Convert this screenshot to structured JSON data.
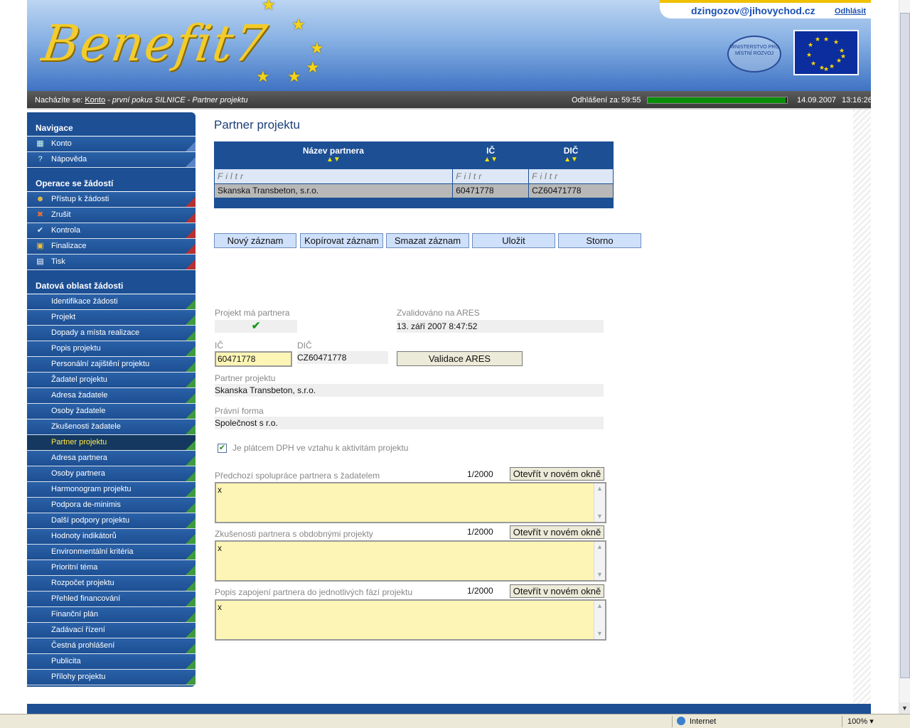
{
  "header": {
    "logo_text": "Benefit7",
    "user_email": "dzingozov@jihovychod.cz",
    "logout_label": "Odhlásit",
    "ministry_text": "MINISTERSTVO PRO MÍSTNÍ ROZVOJ"
  },
  "status": {
    "location_prefix": "Nacházíte se:",
    "location_link": "Konto",
    "location_rest": "- první pokus SILNICE - Partner projektu",
    "timeout_label": "Odhlášení za:",
    "timeout_value": "59:55",
    "timeout_progress_fraction": 0.99,
    "date": "14.09.2007",
    "time": "13:16:26"
  },
  "sidebar": {
    "nav_title": "Navigace",
    "nav_items": [
      {
        "label": "Konto",
        "icon": "account-icon"
      },
      {
        "label": "Nápověda",
        "icon": "help-icon"
      }
    ],
    "ops_title": "Operace se žádostí",
    "ops_items": [
      {
        "label": "Přístup k žádosti",
        "icon": "users-icon"
      },
      {
        "label": "Zrušit",
        "icon": "cancel-icon"
      },
      {
        "label": "Kontrola",
        "icon": "check-icon"
      },
      {
        "label": "Finalizace",
        "icon": "lock-icon"
      },
      {
        "label": "Tisk",
        "icon": "print-icon"
      }
    ],
    "data_title": "Datová oblast žádosti",
    "data_items": [
      "Identifikace žádosti",
      "Projekt",
      "Dopady a místa realizace",
      "Popis projektu",
      "Personální zajištění projektu",
      "Žadatel projektu",
      "Adresa žadatele",
      "Osoby žadatele",
      "Zkušenosti žadatele",
      "Partner projektu",
      "Adresa partnera",
      "Osoby partnera",
      "Harmonogram projektu",
      "Podpora de-minimis",
      "Další podpory projektu",
      "Hodnoty indikátorů",
      "Environmentální kritéria",
      "Prioritní téma",
      "Rozpočet projektu",
      "Přehled financování",
      "Finanční plán",
      "Zadávací řízení",
      "Čestná prohlášení",
      "Publicita",
      "Přílohy projektu"
    ],
    "active_item": "Partner projektu"
  },
  "main": {
    "title": "Partner projektu",
    "table": {
      "columns": [
        "Název partnera",
        "IČ",
        "DIČ"
      ],
      "filter_placeholder": "Filtr",
      "rows": [
        [
          "Skanska Transbeton, s.r.o.",
          "60471778",
          "CZ60471778"
        ]
      ]
    },
    "buttons": {
      "new": "Nový záznam",
      "copy": "Kopírovat záznam",
      "delete": "Smazat záznam",
      "save": "Uložit",
      "cancel": "Storno"
    },
    "form": {
      "has_partner_label": "Projekt má partnera",
      "validated_label": "Zvalidováno na ARES",
      "validated_value": "13. září 2007 8:47:52",
      "ic_label": "IČ",
      "ic_value": "60471778",
      "dic_label": "DIČ",
      "dic_value": "CZ60471778",
      "ares_button": "Validace ARES",
      "partner_label": "Partner projektu",
      "partner_value": "Skanska Transbeton, s.r.o.",
      "legal_form_label": "Právní forma",
      "legal_form_value": "Společnost s r.o.",
      "vat_checkbox_label": "Je plátcem DPH ve vztahu k aktivitám projektu",
      "textareas": [
        {
          "label": "Předchozí spolupráce partnera s žadatelem",
          "counter": "1/2000",
          "value": "x",
          "open_button": "Otevřít v novém okně"
        },
        {
          "label": "Zkušenosti partnera s obdobnými projekty",
          "counter": "1/2000",
          "value": "x",
          "open_button": "Otevřít v novém okně"
        },
        {
          "label": "Popis zapojení partnera do jednotlivých fází projektu",
          "counter": "1/2000",
          "value": "x",
          "open_button": "Otevřít v novém okně"
        }
      ]
    }
  },
  "browser_status": {
    "zone": "Internet",
    "zoom": "100%"
  }
}
